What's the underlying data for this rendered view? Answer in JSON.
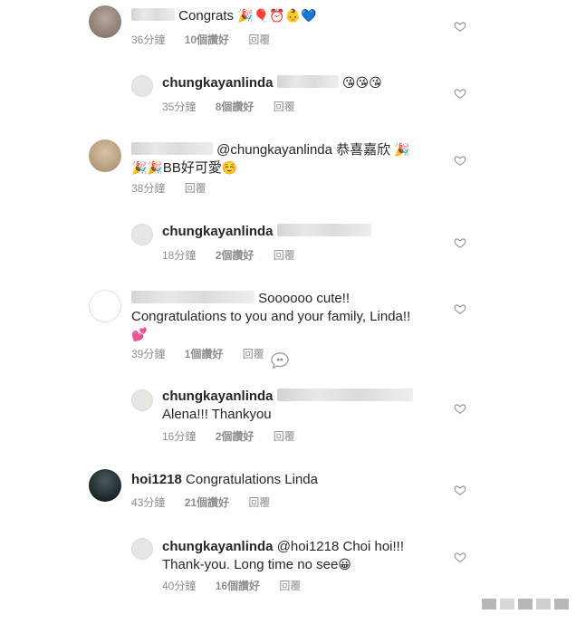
{
  "comments": [
    {
      "text": "Congrats",
      "emoji": "🎉🎈⏰👶💙",
      "time": "36分鐘",
      "likes": "10個讚好",
      "reply": "回覆"
    },
    {
      "username": "chungkayanlinda",
      "emoji": "😘😘😘",
      "time": "35分鐘",
      "likes": "8個讚好",
      "reply": "回覆"
    },
    {
      "text": "@chungkayanlinda 恭喜嘉欣",
      "emoji1": "🎉",
      "line2": "BB好可愛",
      "emoji2a": "🎉🎉",
      "emoji2b": "☺️",
      "time": "38分鐘",
      "reply": "回覆"
    },
    {
      "username": "chungkayanlinda",
      "time": "18分鐘",
      "likes": "2個讚好",
      "reply": "回覆"
    },
    {
      "text": "Soooooo cute!!",
      "line2": "Congratulations to you and your family, Linda!!",
      "emoji": "💕",
      "time": "39分鐘",
      "likes": "1個讚好",
      "reply": "回覆"
    },
    {
      "username": "chungkayanlinda",
      "line2": "Alena!!! Thankyou",
      "time": "16分鐘",
      "likes": "2個讚好",
      "reply": "回覆"
    },
    {
      "username": "hoi1218",
      "text": "Congratulations Linda",
      "time": "43分鐘",
      "likes": "21個讚好",
      "reply": "回覆"
    },
    {
      "username": "chungkayanlinda",
      "text": "@hoi1218 Choi hoi!!!",
      "line2": "Thank-you. Long time no see",
      "emoji": "😀",
      "time": "40分鐘",
      "likes": "16個讚好",
      "reply": "回覆"
    }
  ]
}
